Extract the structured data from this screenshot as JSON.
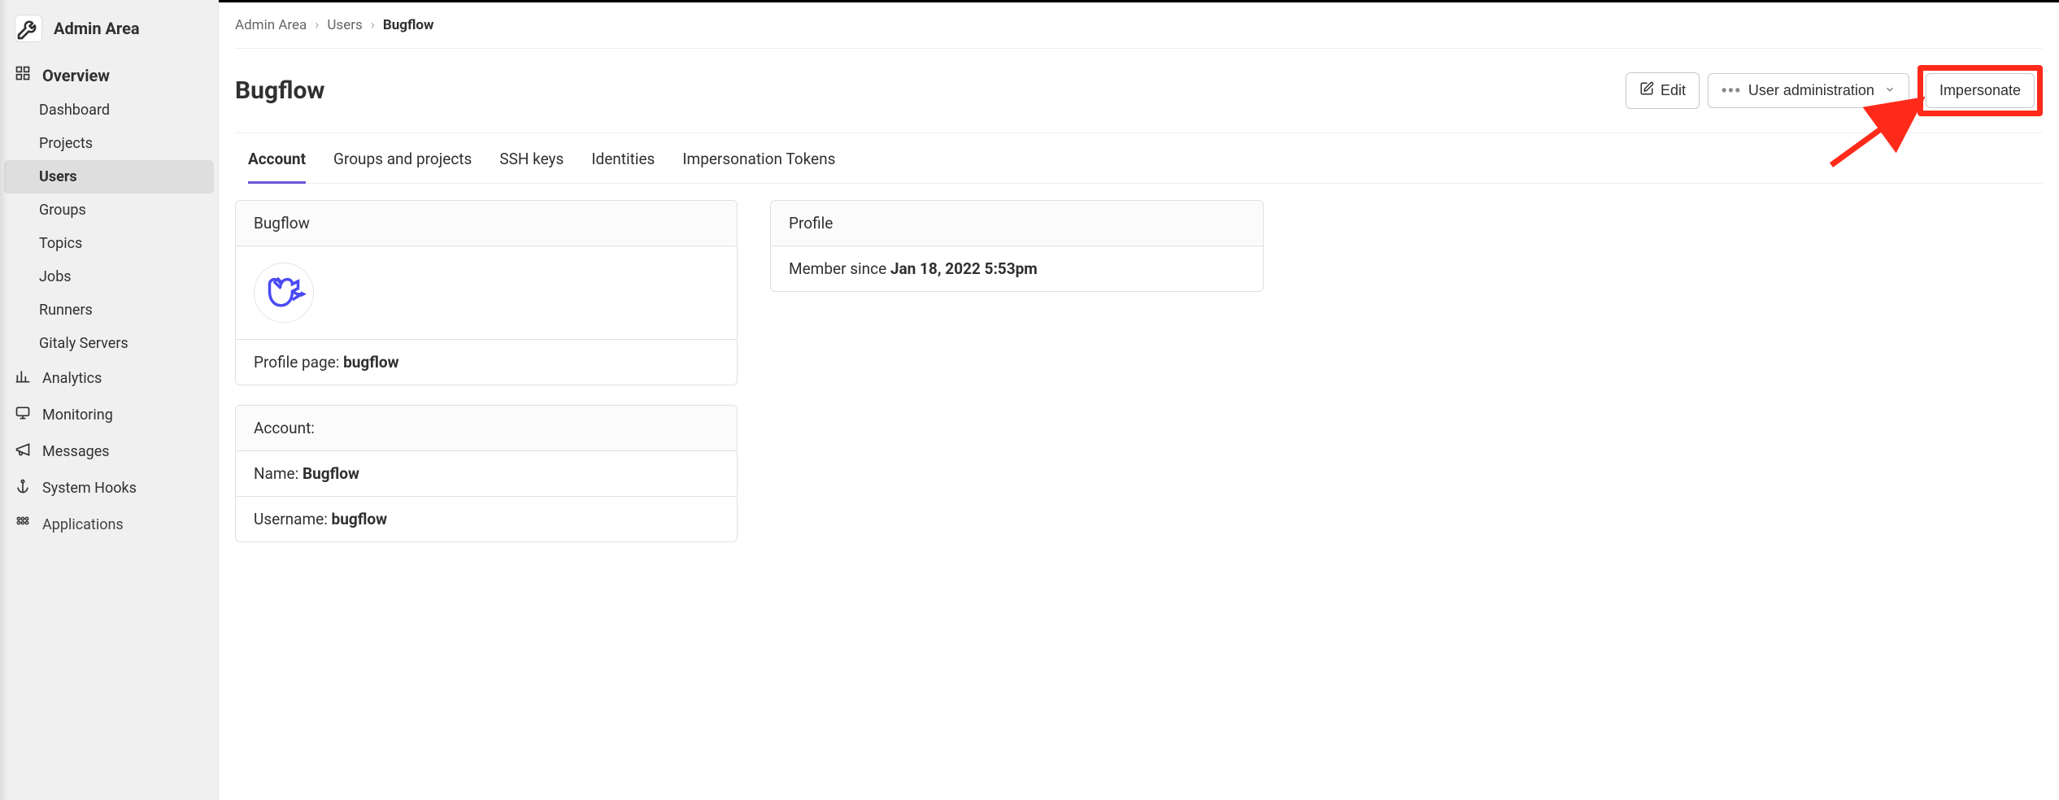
{
  "sidebar": {
    "header": "Admin Area",
    "sections": {
      "overview": {
        "label": "Overview",
        "items": [
          {
            "label": "Dashboard"
          },
          {
            "label": "Projects"
          },
          {
            "label": "Users",
            "active": true
          },
          {
            "label": "Groups"
          },
          {
            "label": "Topics"
          },
          {
            "label": "Jobs"
          },
          {
            "label": "Runners"
          },
          {
            "label": "Gitaly Servers"
          }
        ]
      },
      "other": [
        {
          "label": "Analytics",
          "icon": "chart"
        },
        {
          "label": "Monitoring",
          "icon": "monitor"
        },
        {
          "label": "Messages",
          "icon": "megaphone"
        },
        {
          "label": "System Hooks",
          "icon": "anchor"
        },
        {
          "label": "Applications",
          "icon": "grid"
        }
      ]
    }
  },
  "breadcrumb": {
    "items": [
      "Admin Area",
      "Users"
    ],
    "current": "Bugflow"
  },
  "page": {
    "title": "Bugflow",
    "edit_label": "Edit",
    "user_admin_label": "User administration",
    "impersonate_label": "Impersonate"
  },
  "tabs": [
    {
      "label": "Account",
      "active": true
    },
    {
      "label": "Groups and projects"
    },
    {
      "label": "SSH keys"
    },
    {
      "label": "Identities"
    },
    {
      "label": "Impersonation Tokens"
    }
  ],
  "user_card": {
    "name_head": "Bugflow",
    "profile_page_label": "Profile page: ",
    "profile_page_value": "bugflow"
  },
  "account_card": {
    "head": "Account:",
    "name_label": "Name: ",
    "name_value": "Bugflow",
    "username_label": "Username: ",
    "username_value": "bugflow"
  },
  "profile_card": {
    "head": "Profile",
    "member_since_label": "Member since ",
    "member_since_value": "Jan 18, 2022 5:53pm"
  },
  "annotation": {
    "target": "impersonate-button"
  }
}
